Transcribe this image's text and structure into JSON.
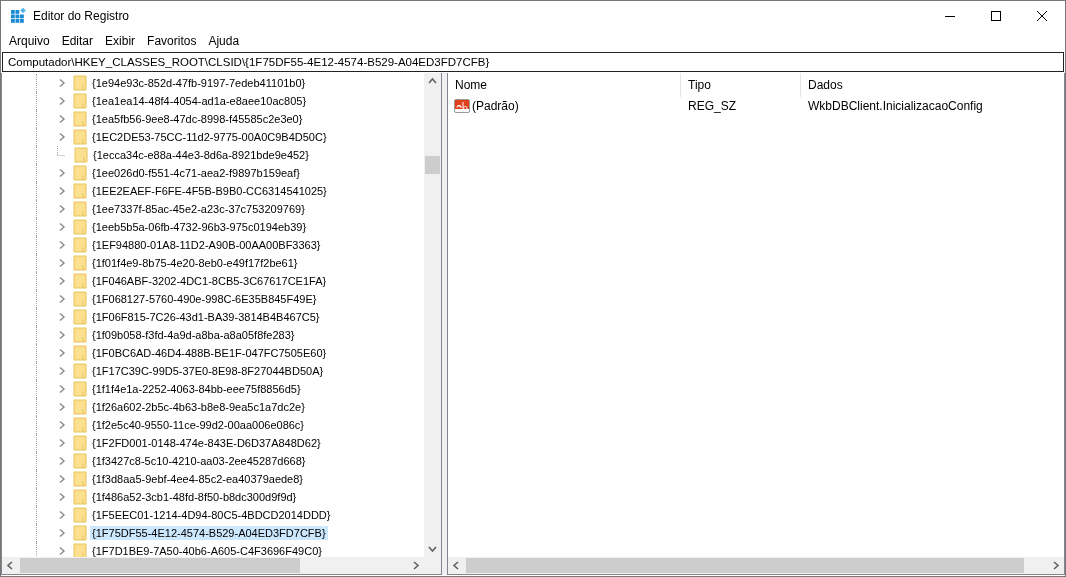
{
  "window": {
    "title": "Editor do Registro"
  },
  "menu": [
    "Arquivo",
    "Editar",
    "Exibir",
    "Favoritos",
    "Ajuda"
  ],
  "address": "Computador\\HKEY_CLASSES_ROOT\\CLSID\\{1F75DF55-4E12-4574-B529-A04ED3FD7CFB}",
  "tree": {
    "items": [
      {
        "label": "{1e94e93c-852d-47fb-9197-7edeb41101b0}",
        "expandable": true,
        "selected": false
      },
      {
        "label": "{1ea1ea14-48f4-4054-ad1a-e8aee10ac805}",
        "expandable": true,
        "selected": false
      },
      {
        "label": "{1ea5fb56-9ee8-47dc-8998-f45585c2e3e0}",
        "expandable": true,
        "selected": false
      },
      {
        "label": "{1EC2DE53-75CC-11d2-9775-00A0C9B4D50C}",
        "expandable": true,
        "selected": false
      },
      {
        "label": "{1ecca34c-e88a-44e3-8d6a-8921bde9e452}",
        "expandable": false,
        "selected": false
      },
      {
        "label": "{1ee026d0-f551-4c71-aea2-f9897b159eaf}",
        "expandable": true,
        "selected": false
      },
      {
        "label": "{1EE2EAEF-F6FE-4F5B-B9B0-CC6314541025}",
        "expandable": true,
        "selected": false
      },
      {
        "label": "{1ee7337f-85ac-45e2-a23c-37c753209769}",
        "expandable": true,
        "selected": false
      },
      {
        "label": "{1eeb5b5a-06fb-4732-96b3-975c0194eb39}",
        "expandable": true,
        "selected": false
      },
      {
        "label": "{1EF94880-01A8-11D2-A90B-00AA00BF3363}",
        "expandable": true,
        "selected": false
      },
      {
        "label": "{1f01f4e9-8b75-4e20-8eb0-e49f17f2be61}",
        "expandable": true,
        "selected": false
      },
      {
        "label": "{1F046ABF-3202-4DC1-8CB5-3C67617CE1FA}",
        "expandable": true,
        "selected": false
      },
      {
        "label": "{1F068127-5760-490e-998C-6E35B845F49E}",
        "expandable": true,
        "selected": false
      },
      {
        "label": "{1F06F815-7C26-43d1-BA39-3814B4B467C5}",
        "expandable": true,
        "selected": false
      },
      {
        "label": "{1f09b058-f3fd-4a9d-a8ba-a8a05f8fe283}",
        "expandable": true,
        "selected": false
      },
      {
        "label": "{1F0BC6AD-46D4-488B-BE1F-047FC7505E60}",
        "expandable": true,
        "selected": false
      },
      {
        "label": "{1F17C39C-99D5-37E0-8E98-8F27044BD50A}",
        "expandable": true,
        "selected": false
      },
      {
        "label": "{1f1f4e1a-2252-4063-84bb-eee75f8856d5}",
        "expandable": true,
        "selected": false
      },
      {
        "label": "{1f26a602-2b5c-4b63-b8e8-9ea5c1a7dc2e}",
        "expandable": true,
        "selected": false
      },
      {
        "label": "{1f2e5c40-9550-11ce-99d2-00aa006e086c}",
        "expandable": true,
        "selected": false
      },
      {
        "label": "{1F2FD001-0148-474e-843E-D6D37A848D62}",
        "expandable": true,
        "selected": false
      },
      {
        "label": "{1f3427c8-5c10-4210-aa03-2ee45287d668}",
        "expandable": true,
        "selected": false
      },
      {
        "label": "{1f3d8aa5-9ebf-4ee4-85c2-ea40379aede8}",
        "expandable": true,
        "selected": false
      },
      {
        "label": "{1f486a52-3cb1-48fd-8f50-b8dc300d9f9d}",
        "expandable": true,
        "selected": false
      },
      {
        "label": "{1F5EEC01-1214-4D94-80C5-4BDCD2014DDD}",
        "expandable": true,
        "selected": false
      },
      {
        "label": "{1F75DF55-4E12-4574-B529-A04ED3FD7CFB}",
        "expandable": true,
        "selected": true
      },
      {
        "label": "{1F7D1BE9-7A50-40b6-A605-C4F3696F49C0}",
        "expandable": true,
        "selected": false
      }
    ]
  },
  "values": {
    "columns": [
      "Nome",
      "Tipo",
      "Dados"
    ],
    "rows": [
      {
        "name": "(Padrão)",
        "type": "REG_SZ",
        "data": "WkbDBClient.InicializacaoConfig"
      }
    ]
  }
}
